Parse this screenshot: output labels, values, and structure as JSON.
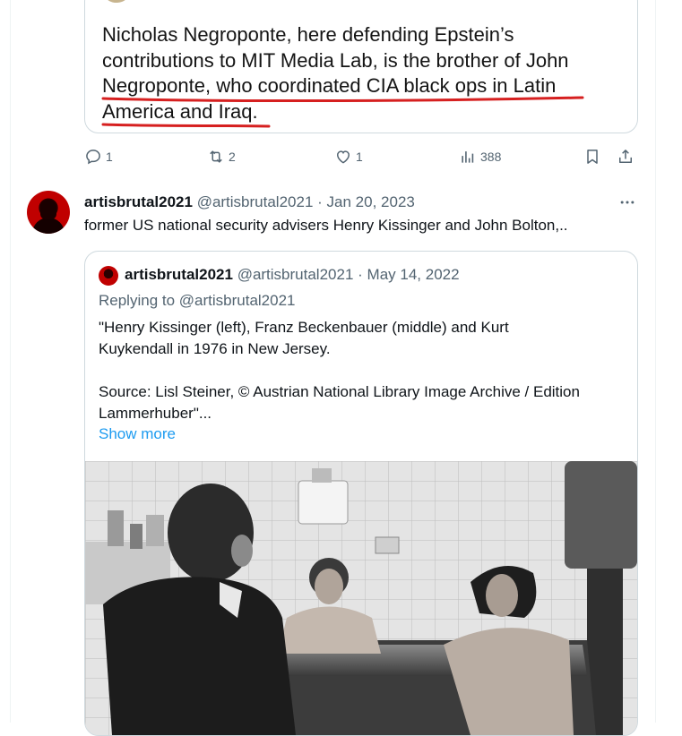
{
  "first_tweet": {
    "image_text": {
      "line1": "Nicholas Negroponte, here defending Epstein’s",
      "line2": "contributions to MIT Media Lab, is the brother of John",
      "line3": "Negroponte, who coordinated CIA black ops in Latin",
      "line4": "America and Iraq."
    },
    "actions": {
      "replies": "1",
      "retweets": "2",
      "likes": "1",
      "views": "388"
    }
  },
  "second_tweet": {
    "display_name": "artisbrutal2021",
    "handle": "@artisbrutal2021",
    "separator": "·",
    "date": "Jan 20, 2023",
    "more_icon": "more-horizontal-icon",
    "text": "former US national security advisers Henry Kissinger and John Bolton,..",
    "quote": {
      "display_name": "artisbrutal2021",
      "handle": "@artisbrutal2021",
      "separator": "·",
      "date": "May 14, 2022",
      "replying_to": "Replying to @artisbrutal2021",
      "text": "\"Henry Kissinger (left), Franz Beckenbauer (middle) and Kurt\nKuykendall in 1976 in New Jersey.\n\nSource: Lisl Steiner, © Austrian National Library Image Archive / Edition\nLammerhuber\"...",
      "show_more": "Show more"
    }
  },
  "colors": {
    "muted": "#536471",
    "link": "#1d9bf0",
    "border": "#cfd9de",
    "underline_red": "#d62020"
  }
}
